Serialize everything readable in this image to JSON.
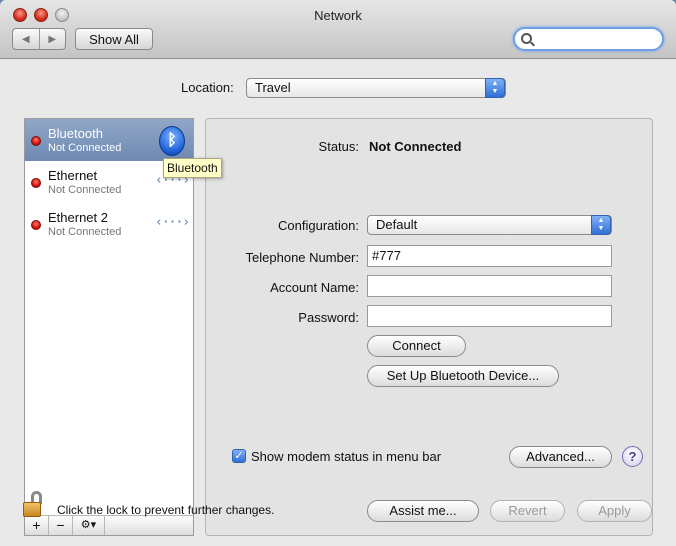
{
  "window": {
    "title": "Network"
  },
  "toolbar": {
    "back_glyph": "◀",
    "forward_glyph": "▶",
    "show_all": "Show All",
    "search_value": ""
  },
  "location": {
    "label": "Location:",
    "value": "Travel"
  },
  "services": [
    {
      "name": "Bluetooth",
      "status": "Not Connected",
      "icon": "bluetooth-icon"
    },
    {
      "name": "Ethernet",
      "status": "Not Connected",
      "icon": "ethernet-icon"
    },
    {
      "name": "Ethernet 2",
      "status": "Not Connected",
      "icon": "ethernet-icon"
    }
  ],
  "tooltip": "Bluetooth",
  "sidebar_bar": {
    "add": "+",
    "remove": "−",
    "action": "⚙▾"
  },
  "panel": {
    "status_label": "Status:",
    "status_value": "Not Connected",
    "configuration_label": "Configuration:",
    "configuration_value": "Default",
    "telephone_label": "Telephone Number:",
    "telephone_value": "#777",
    "account_label": "Account Name:",
    "account_value": "",
    "password_label": "Password:",
    "password_value": "",
    "connect": "Connect",
    "setup_bt": "Set Up Bluetooth Device...",
    "show_modem": "Show modem status in menu bar",
    "show_modem_checked": true,
    "advanced": "Advanced...",
    "help": "?"
  },
  "footer": {
    "lock_text": "Click the lock to prevent further changes.",
    "assist": "Assist me...",
    "revert": "Revert",
    "apply": "Apply"
  }
}
